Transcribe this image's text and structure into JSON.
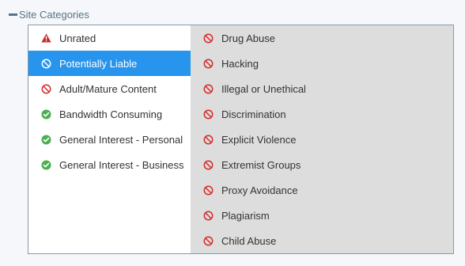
{
  "section": {
    "title": "Site Categories"
  },
  "colors": {
    "accent": "#2795ee",
    "block": "#d62b2b",
    "allow": "#4caf50",
    "warn": "#c62828"
  },
  "left_items": [
    {
      "label": "Unrated",
      "icon": "warning-icon",
      "selected": false
    },
    {
      "label": "Potentially Liable",
      "icon": "block-icon",
      "selected": true
    },
    {
      "label": "Adult/Mature Content",
      "icon": "block-icon",
      "selected": false
    },
    {
      "label": "Bandwidth Consuming",
      "icon": "check-circle-icon",
      "selected": false
    },
    {
      "label": "General Interest - Personal",
      "icon": "check-circle-icon",
      "selected": false
    },
    {
      "label": "General Interest - Business",
      "icon": "check-circle-icon",
      "selected": false
    }
  ],
  "right_items": [
    {
      "label": "Drug Abuse",
      "icon": "block-icon"
    },
    {
      "label": "Hacking",
      "icon": "block-icon"
    },
    {
      "label": "Illegal or Unethical",
      "icon": "block-icon"
    },
    {
      "label": "Discrimination",
      "icon": "block-icon"
    },
    {
      "label": "Explicit Violence",
      "icon": "block-icon"
    },
    {
      "label": "Extremist Groups",
      "icon": "block-icon"
    },
    {
      "label": "Proxy Avoidance",
      "icon": "block-icon"
    },
    {
      "label": "Plagiarism",
      "icon": "block-icon"
    },
    {
      "label": "Child Abuse",
      "icon": "block-icon"
    }
  ]
}
